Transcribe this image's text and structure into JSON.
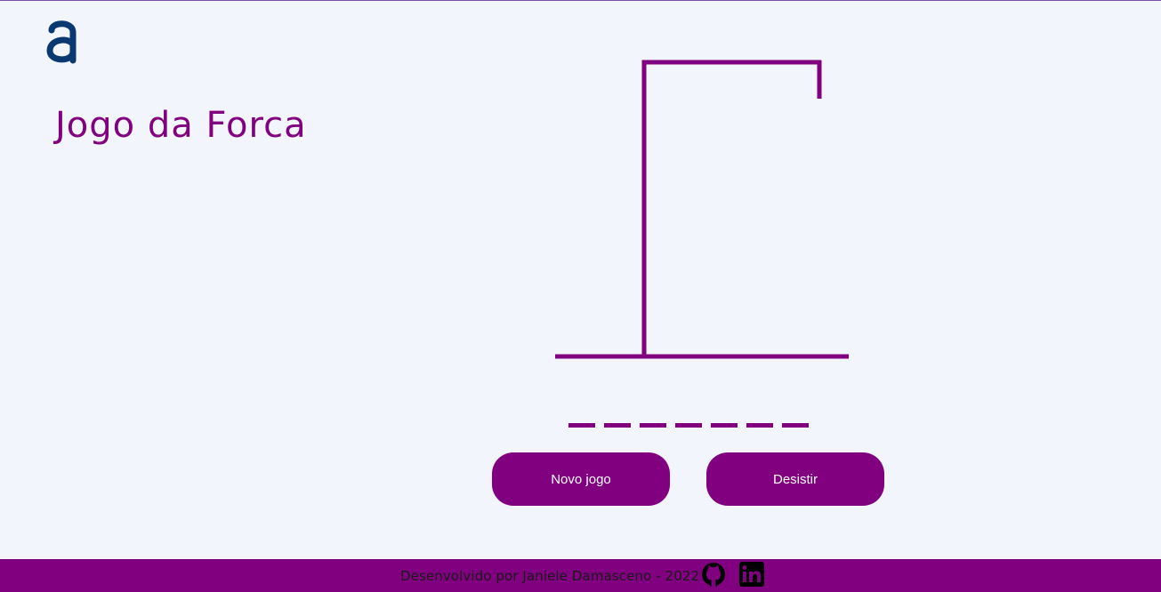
{
  "app": {
    "logo_icon": "alura-a-logo",
    "title": "Jogo da Forca"
  },
  "game": {
    "hidden_word_length": 7,
    "errors": 0
  },
  "buttons": {
    "new_game_label": "Novo jogo",
    "give_up_label": "Desistir"
  },
  "footer": {
    "credit_text": "Desenvolvido por Janiele Damasceno - 2022",
    "icons": [
      "github-icon",
      "linkedin-icon"
    ]
  },
  "colors": {
    "accent": "#800080",
    "background": "#F3F5FC",
    "logo": "#0A3871"
  }
}
